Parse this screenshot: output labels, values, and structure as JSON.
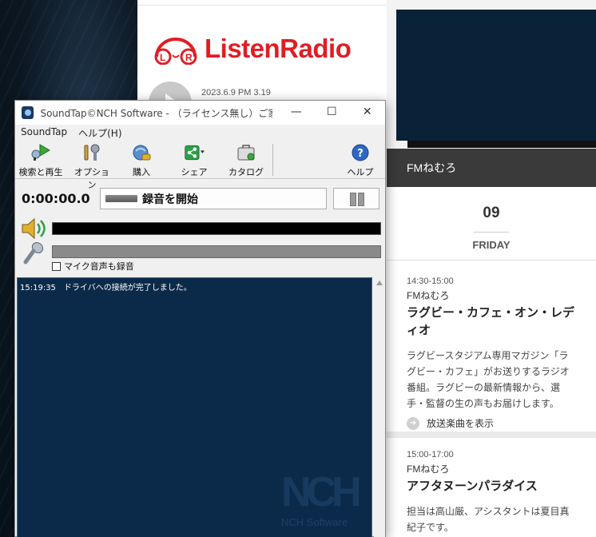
{
  "website": {
    "logo_text": "ListenRadio",
    "logo_mark_letters": "LR",
    "datetime": "2023.6.9 PM 3.19",
    "station_header": "FMねむろ",
    "date": {
      "day": "09",
      "weekday": "FRIDAY"
    },
    "programs": [
      {
        "time": "14:30-15:00",
        "station": "FMねむろ",
        "title": "ラグビー・カフェ・オン・レディオ",
        "description": "ラグビースタジアム専用マガジン「ラグビー・カフェ」がお送りするラジオ番組。ラグビーの最新情報から、選手・監督の生の声もお届けします。",
        "link": "放送楽曲を表示"
      },
      {
        "time": "15:00-17:00",
        "station": "FMねむろ",
        "title": "アフタヌーンパラダイス",
        "description": "担当は高山厳、アシスタントは夏目真紀子です。"
      }
    ]
  },
  "soundtap": {
    "title": "SoundTap©NCH Software - （ライセンス無し）ご家庭で...",
    "window_controls": {
      "minimize": "—",
      "maximize": "☐",
      "close": "✕"
    },
    "menu": [
      "SoundTap",
      "ヘルプ(H)"
    ],
    "toolbar": [
      {
        "label": "検索と再生",
        "icon": "search-play-icon"
      },
      {
        "label": "オプション",
        "icon": "options-icon"
      },
      {
        "label": "購入",
        "icon": "buy-icon"
      },
      {
        "label": "シェア",
        "icon": "share-icon"
      },
      {
        "label": "カタログ",
        "icon": "catalog-icon"
      },
      {
        "label": "ヘルプ",
        "icon": "help-icon"
      }
    ],
    "timer": "0:00:00.0",
    "record_button": "録音を開始",
    "mic_checkbox": {
      "label": "マイク音声も録音",
      "checked": false
    },
    "log": [
      {
        "time": "15:19:35",
        "message": "ドライバへの接続が完了しました。"
      }
    ],
    "watermark": {
      "logo": "NCH",
      "company": "NCH Software"
    },
    "colors": {
      "log_bg": "#0b2a4a",
      "brand_red": "#e11d24"
    }
  }
}
